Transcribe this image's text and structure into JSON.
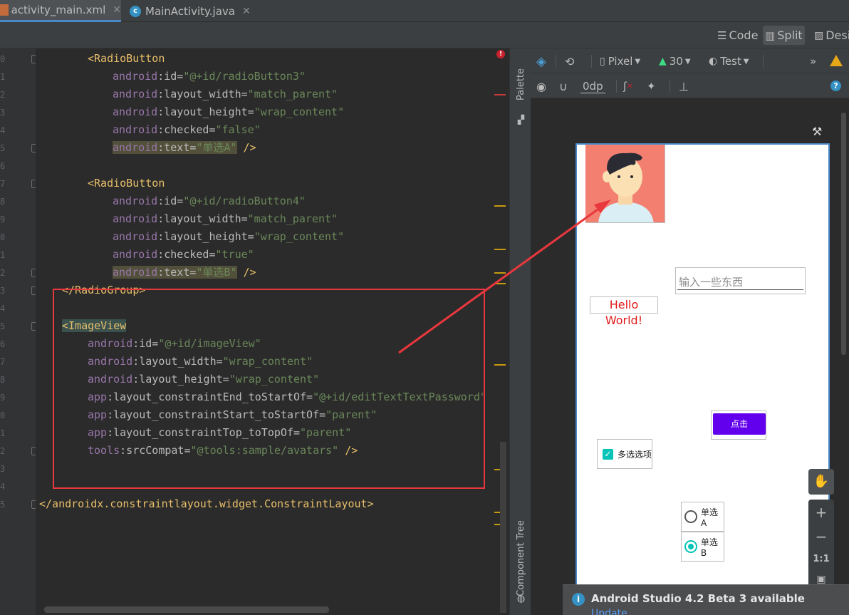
{
  "tabs": [
    {
      "label": "activity_main.xml",
      "active": true
    },
    {
      "label": "MainActivity.java",
      "active": false
    }
  ],
  "view_modes": {
    "code": "Code",
    "split": "Split",
    "design": "Desi"
  },
  "gutter": {
    "line_digits": [
      "0",
      "1",
      "2",
      "3",
      "4",
      "5",
      "6",
      "7",
      "8",
      "9",
      "0",
      "1",
      "2",
      "3",
      "4",
      "5",
      "6",
      "7",
      "8",
      "9",
      "0",
      "1",
      "2",
      "3",
      "4",
      "5"
    ]
  },
  "code": {
    "lines": [
      {
        "parts": [
          [
            "tag",
            "<RadioButton"
          ]
        ]
      },
      {
        "parts": [
          [
            "ns",
            "android"
          ],
          [
            "attr",
            ":id="
          ],
          [
            "str",
            "\"@+id/radioButton3\""
          ]
        ]
      },
      {
        "parts": [
          [
            "ns",
            "android"
          ],
          [
            "attr",
            ":layout_width="
          ],
          [
            "str",
            "\"match_parent\""
          ]
        ]
      },
      {
        "parts": [
          [
            "ns",
            "android"
          ],
          [
            "attr",
            ":layout_height="
          ],
          [
            "str",
            "\"wrap_content\""
          ]
        ]
      },
      {
        "parts": [
          [
            "ns",
            "android"
          ],
          [
            "attr",
            ":checked="
          ],
          [
            "str",
            "\"false\""
          ]
        ]
      },
      {
        "parts": [
          [
            "ns hl",
            "android"
          ],
          [
            "attr hl",
            ":text="
          ],
          [
            "str hl",
            "\"单选A\""
          ],
          [
            "punct",
            " />"
          ]
        ]
      },
      {
        "parts": []
      },
      {
        "parts": [
          [
            "tag",
            "<RadioButton"
          ]
        ]
      },
      {
        "parts": [
          [
            "ns",
            "android"
          ],
          [
            "attr",
            ":id="
          ],
          [
            "str",
            "\"@+id/radioButton4\""
          ]
        ]
      },
      {
        "parts": [
          [
            "ns",
            "android"
          ],
          [
            "attr",
            ":layout_width="
          ],
          [
            "str",
            "\"match_parent\""
          ]
        ]
      },
      {
        "parts": [
          [
            "ns",
            "android"
          ],
          [
            "attr",
            ":layout_height="
          ],
          [
            "str",
            "\"wrap_content\""
          ]
        ]
      },
      {
        "parts": [
          [
            "ns",
            "android"
          ],
          [
            "attr",
            ":checked="
          ],
          [
            "str",
            "\"true\""
          ]
        ]
      },
      {
        "parts": [
          [
            "ns hl",
            "android"
          ],
          [
            "attr hl",
            ":text="
          ],
          [
            "str hl",
            "\"单选B\""
          ],
          [
            "punct",
            " />"
          ]
        ]
      },
      {
        "parts": [
          [
            "tag",
            "</RadioGroup>"
          ]
        ]
      },
      {
        "parts": []
      },
      {
        "parts": [
          [
            "tag hl-tag",
            "<ImageView"
          ]
        ]
      },
      {
        "parts": [
          [
            "ns",
            "android"
          ],
          [
            "attr",
            ":id="
          ],
          [
            "str",
            "\"@+id/imageView\""
          ]
        ]
      },
      {
        "parts": [
          [
            "ns",
            "android"
          ],
          [
            "attr",
            ":layout_width="
          ],
          [
            "str",
            "\"wrap_content\""
          ]
        ]
      },
      {
        "parts": [
          [
            "ns",
            "android"
          ],
          [
            "attr",
            ":layout_height="
          ],
          [
            "str",
            "\"wrap_content\""
          ]
        ]
      },
      {
        "parts": [
          [
            "ns",
            "app"
          ],
          [
            "attr",
            ":layout_constraintEnd_toStartOf="
          ],
          [
            "str",
            "\"@+id/editTextTextPassword\""
          ]
        ]
      },
      {
        "parts": [
          [
            "ns",
            "app"
          ],
          [
            "attr",
            ":layout_constraintStart_toStartOf="
          ],
          [
            "str",
            "\"parent\""
          ]
        ]
      },
      {
        "parts": [
          [
            "ns",
            "app"
          ],
          [
            "attr",
            ":layout_constraintTop_toTopOf="
          ],
          [
            "str",
            "\"parent\""
          ]
        ]
      },
      {
        "parts": [
          [
            "ns",
            "tools"
          ],
          [
            "attr",
            ":srcCompat="
          ],
          [
            "str",
            "\"@tools:sample/avatars\""
          ],
          [
            "punct",
            " />"
          ]
        ]
      },
      {
        "parts": []
      },
      {
        "parts": []
      },
      {
        "parts": [
          [
            "tag",
            "</androidx.constraintlayout.widget.ConstraintLayout>"
          ]
        ]
      }
    ]
  },
  "side_tabs": {
    "palette": "Palette",
    "component_tree": "Component Tree"
  },
  "design_toolbar": {
    "device": "Pixel",
    "api": "30",
    "theme": "Test",
    "margin": "0dp"
  },
  "preview": {
    "edit_text_hint": "输入一些东西",
    "hello_text": "Hello World!",
    "button_label": "点击",
    "checkbox_label": "多选选项",
    "radio_a_label": "单选A",
    "radio_b_label": "单选B",
    "radio_a_checked": false,
    "radio_b_checked": true,
    "checkbox_checked": true
  },
  "zoom": {
    "plus": "+",
    "minus": "−",
    "one_to_one": "1:1"
  },
  "notification": {
    "title": "Android Studio 4.2 Beta 3 available",
    "link": "Update..."
  },
  "colors": {
    "accent": "#6200ee",
    "teal": "#03c4b6",
    "annotation_red": "#e8373d",
    "error_red": "#c7222d",
    "warning": "#e6a817"
  }
}
